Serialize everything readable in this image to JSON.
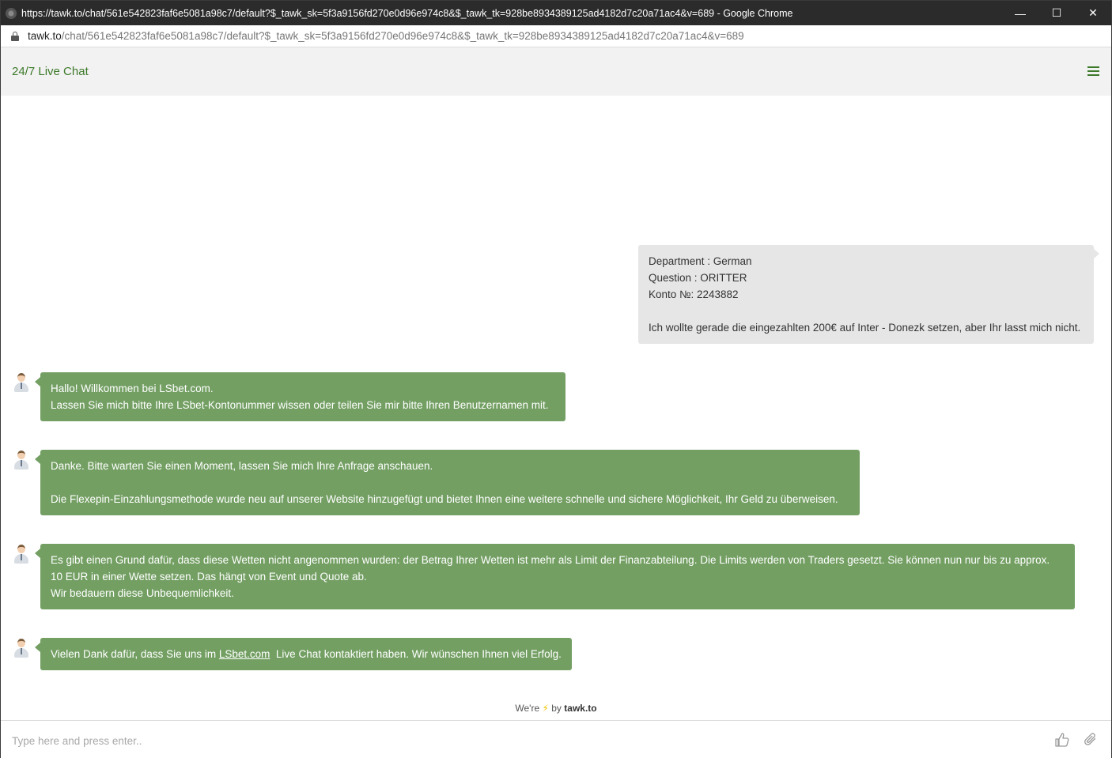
{
  "window": {
    "title": "https://tawk.to/chat/561e542823faf6e5081a98c7/default?$_tawk_sk=5f3a9156fd270e0d96e974c8&$_tawk_tk=928be8934389125ad4182d7c20a71ac4&v=689 - Google Chrome",
    "minimize": "—",
    "maximize": "☐",
    "close": "✕"
  },
  "address": {
    "host": "tawk.to",
    "path": "/chat/561e542823faf6e5081a98c7/default?$_tawk_sk=5f3a9156fd270e0d96e974c8&$_tawk_tk=928be8934389125ad4182d7c20a71ac4&v=689"
  },
  "header": {
    "title": "24/7 Live Chat"
  },
  "visitor_message": {
    "line1": "Department : German",
    "line2": "Question : ORITTER",
    "line3": "Konto №: 2243882",
    "line4": "Ich wollte gerade die eingezahlten 200€ auf Inter - Donezk setzen, aber Ihr lasst mich nicht."
  },
  "agent_messages": {
    "m1": {
      "line1": "Hallo! Willkommen bei LSbet.com.",
      "line2": "Lassen Sie mich bitte Ihre LSbet-Kontonummer wissen oder teilen Sie mir bitte Ihren Benutzernamen mit."
    },
    "m2": {
      "line1": "Danke. Bitte warten Sie einen Moment, lassen Sie mich Ihre Anfrage anschauen.",
      "line2": "Die Flexepin-Einzahlungsmethode wurde neu auf unserer Website hinzugefügt und bietet Ihnen eine weitere schnelle und sichere Möglichkeit, Ihr Geld zu überweisen."
    },
    "m3": {
      "line1": "Es gibt einen Grund dafür, dass diese Wetten nicht angenommen wurden: der Betrag Ihrer Wetten ist mehr als Limit der Finanzabteilung. Die Limits werden von Traders gesetzt. Sie können nun nur bis zu approx.",
      "line2": "10 EUR in einer Wette setzen. Das hängt von Event und Quote ab.",
      "line3": "Wir bedauern diese Unbequemlichkeit."
    },
    "m4": {
      "before": "Vielen Dank dafür, dass Sie uns im ",
      "link": "LSbet.com",
      "after": "  Live Chat kontaktiert haben. Wir wünschen Ihnen viel Erfolg."
    }
  },
  "footer": {
    "prefix": "We're",
    "bolt": "⚡",
    "by": "by",
    "brand": "tawk.to"
  },
  "composer": {
    "placeholder": "Type here and press enter.."
  },
  "icons": [
    "lock-icon",
    "menu-icon",
    "agent-avatar",
    "thumbs-up-icon",
    "paperclip-icon"
  ]
}
